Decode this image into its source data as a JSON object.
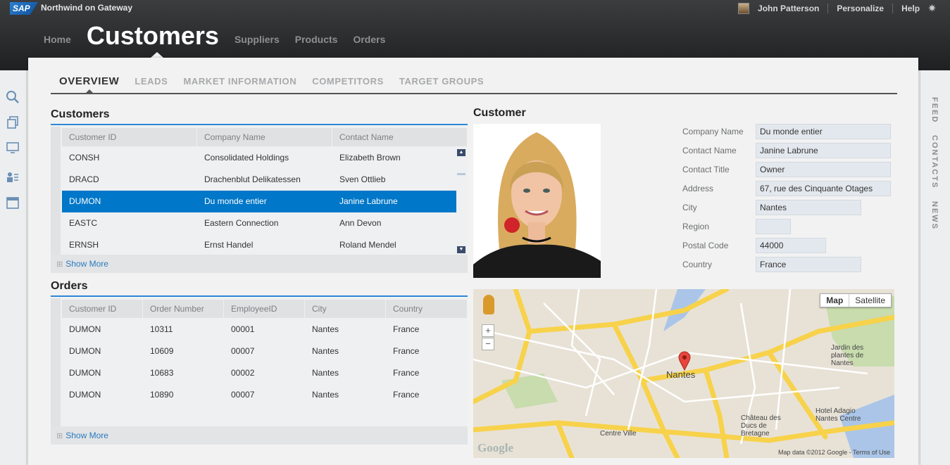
{
  "app": {
    "logo": "SAP",
    "title": "Northwind on Gateway"
  },
  "user": {
    "name": "John Patterson",
    "personalize": "Personalize",
    "help": "Help"
  },
  "top_nav": [
    "Home",
    "Customers",
    "Suppliers",
    "Products",
    "Orders"
  ],
  "sub_tabs": [
    "OVERVIEW",
    "LEADS",
    "MARKET INFORMATION",
    "COMPETITORS",
    "TARGET GROUPS"
  ],
  "right_rail": [
    "FEED",
    "CONTACTS",
    "NEWS"
  ],
  "customers": {
    "title": "Customers",
    "columns": [
      "Customer ID",
      "Company Name",
      "Contact Name"
    ],
    "rows": [
      [
        "CONSH",
        "Consolidated Holdings",
        "Elizabeth Brown"
      ],
      [
        "DRACD",
        "Drachenblut Delikatessen",
        "Sven Ottlieb"
      ],
      [
        "DUMON",
        "Du monde entier",
        "Janine Labrune"
      ],
      [
        "EASTC",
        "Eastern Connection",
        "Ann Devon"
      ],
      [
        "ERNSH",
        "Ernst Handel",
        "Roland Mendel"
      ]
    ],
    "selected_index": 2,
    "show_more": "Show More"
  },
  "orders": {
    "title": "Orders",
    "columns": [
      "Customer ID",
      "Order Number",
      "EmployeeID",
      "City",
      "Country"
    ],
    "rows": [
      [
        "DUMON",
        "10311",
        "00001",
        "Nantes",
        "France"
      ],
      [
        "DUMON",
        "10609",
        "00007",
        "Nantes",
        "France"
      ],
      [
        "DUMON",
        "10683",
        "00002",
        "Nantes",
        "France"
      ],
      [
        "DUMON",
        "10890",
        "00007",
        "Nantes",
        "France"
      ]
    ],
    "show_more": "Show More"
  },
  "customer_detail": {
    "title": "Customer",
    "fields": [
      {
        "label": "Company Name",
        "value": "Du monde entier"
      },
      {
        "label": "Contact Name",
        "value": "Janine Labrune"
      },
      {
        "label": "Contact Title",
        "value": "Owner"
      },
      {
        "label": "Address",
        "value": "67, rue des Cinquante Otages"
      },
      {
        "label": "City",
        "value": "Nantes"
      },
      {
        "label": "Region",
        "value": ""
      },
      {
        "label": "Postal Code",
        "value": "44000"
      },
      {
        "label": "Country",
        "value": "France"
      }
    ]
  },
  "map": {
    "type_map": "Map",
    "type_satellite": "Satellite",
    "pin_label": "Nantes",
    "labels": [
      "Centre Ville",
      "Jardin des plantes de Nantes",
      "Château des Ducs de Bretagne",
      "Hotel Adagio Nantes Centre"
    ],
    "footer": "Map data ©2012 Google - Terms of Use",
    "logo": "Google"
  },
  "colors": {
    "accent": "#2b88d8",
    "selected_row": "#0077c8",
    "shell_dark": "#2a2b2d"
  }
}
